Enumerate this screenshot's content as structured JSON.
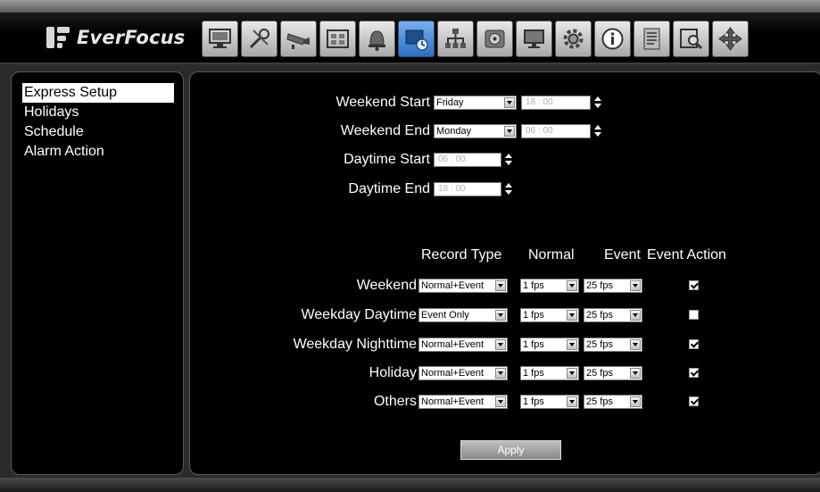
{
  "header": {
    "logo_text": "EverFocus",
    "toolbar_icons": [
      "monitor-icon",
      "tools-icon",
      "camera-icon",
      "film-icon",
      "bell-icon",
      "record-icon",
      "network-icon",
      "disk-icon",
      "display-icon",
      "gear-icon",
      "info-icon",
      "log-icon",
      "search-icon",
      "ptz-icon"
    ],
    "active_icon": "record-icon"
  },
  "sidebar": {
    "items": [
      {
        "label": "Express Setup",
        "selected": true
      },
      {
        "label": "Holidays",
        "selected": false
      },
      {
        "label": "Schedule",
        "selected": false
      },
      {
        "label": "Alarm Action",
        "selected": false
      }
    ]
  },
  "schedule": {
    "weekend_start": {
      "label": "Weekend Start",
      "day": "Friday",
      "time": "18 : 00"
    },
    "weekend_end": {
      "label": "Weekend End",
      "day": "Monday",
      "time": "06 : 00"
    },
    "daytime_start": {
      "label": "Daytime Start",
      "time": "06 : 00"
    },
    "daytime_end": {
      "label": "Daytime End",
      "time": "18 : 00"
    }
  },
  "record_table": {
    "headers": {
      "record_type": "Record Type",
      "normal": "Normal",
      "event": "Event",
      "event_action": "Event Action"
    },
    "rows": [
      {
        "label": "Weekend",
        "record_type": "Normal+Event",
        "normal": "1 fps",
        "event": "25 fps",
        "event_action": true
      },
      {
        "label": "Weekday Daytime",
        "record_type": "Event Only",
        "normal": "1 fps",
        "event": "25 fps",
        "event_action": false
      },
      {
        "label": "Weekday Nighttime",
        "record_type": "Normal+Event",
        "normal": "1 fps",
        "event": "25 fps",
        "event_action": true
      },
      {
        "label": "Holiday",
        "record_type": "Normal+Event",
        "normal": "1 fps",
        "event": "25 fps",
        "event_action": true
      },
      {
        "label": "Others",
        "record_type": "Normal+Event",
        "normal": "1 fps",
        "event": "25 fps",
        "event_action": true
      }
    ]
  },
  "apply_label": "Apply",
  "colors": {
    "accent_active": "#2e6fc4",
    "panel_bg": "#000000",
    "frame": "#2b2b2b"
  }
}
